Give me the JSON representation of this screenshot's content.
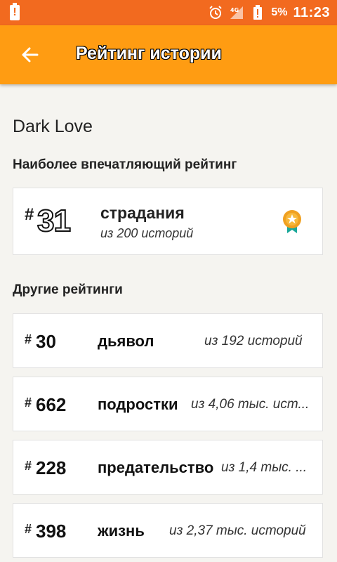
{
  "status_bar": {
    "battery_percent": "5%",
    "time": "11:23",
    "network": "4G"
  },
  "app_bar": {
    "title": "Рейтинг истории"
  },
  "story": {
    "title": "Dark Love"
  },
  "featured_section": {
    "heading": "Наиболее впечатляющий рейтинг",
    "rank_hash": "#",
    "rank": "31",
    "tag": "страдания",
    "subtitle": "из 200 историй"
  },
  "other_section": {
    "heading": "Другие рейтинги",
    "items": [
      {
        "hash": "#",
        "rank": "30",
        "tag": "дьявол",
        "subtitle": "из 192 историй"
      },
      {
        "hash": "#",
        "rank": "662",
        "tag": "подростки",
        "subtitle": "из 4,06 тыс. ист..."
      },
      {
        "hash": "#",
        "rank": "228",
        "tag": "предательство",
        "subtitle": "из 1,4 тыс. ..."
      },
      {
        "hash": "#",
        "rank": "398",
        "tag": "жизнь",
        "subtitle": "из 2,37 тыс. историй"
      }
    ]
  },
  "colors": {
    "status_bar": "#f26a1f",
    "app_bar": "#ff9c12",
    "background": "#f5f4f0",
    "medal": "#f0a020",
    "ribbon": "#1aa89a"
  }
}
